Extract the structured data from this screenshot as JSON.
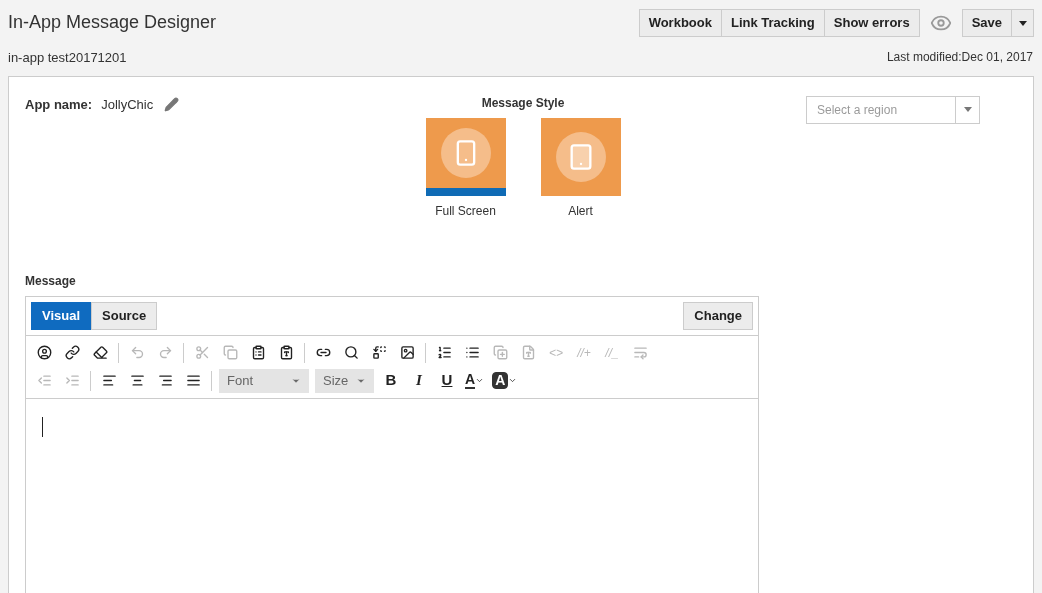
{
  "header": {
    "title": "In-App Message Designer",
    "subtitle": "in-app test20171201",
    "actions": [
      "Workbook",
      "Link Tracking",
      "Show errors"
    ],
    "save": "Save",
    "last_modified": "Last modified:Dec 01, 2017"
  },
  "app": {
    "label": "App name:",
    "value": "JollyChic"
  },
  "message_style": {
    "title": "Message Style",
    "options": [
      {
        "label": "Full Screen",
        "kind": "full",
        "selected": true
      },
      {
        "label": "Alert",
        "kind": "alert",
        "selected": false
      }
    ]
  },
  "region": {
    "placeholder": "Select a region"
  },
  "message": {
    "label": "Message",
    "tabs": [
      {
        "label": "Visual",
        "selected": true
      },
      {
        "label": "Source",
        "selected": false
      }
    ],
    "change": "Change",
    "toolbar_rows": [
      [
        {
          "kind": "user",
          "disabled": false
        },
        {
          "kind": "link",
          "disabled": false
        },
        {
          "kind": "eraser",
          "disabled": false
        },
        {
          "kind": "sep"
        },
        {
          "kind": "undo",
          "disabled": true
        },
        {
          "kind": "redo",
          "disabled": true
        },
        {
          "kind": "sep"
        },
        {
          "kind": "cut",
          "disabled": true
        },
        {
          "kind": "copy",
          "disabled": true
        },
        {
          "kind": "paste",
          "disabled": false
        },
        {
          "kind": "paste-text",
          "disabled": false
        },
        {
          "kind": "sep"
        },
        {
          "kind": "link2",
          "disabled": false
        },
        {
          "kind": "search",
          "disabled": false
        },
        {
          "kind": "replace",
          "disabled": false
        },
        {
          "kind": "image",
          "disabled": false
        },
        {
          "kind": "sep"
        },
        {
          "kind": "ordered",
          "disabled": false
        },
        {
          "kind": "bullets",
          "disabled": false
        },
        {
          "kind": "format-copy",
          "disabled": true
        },
        {
          "kind": "format-doc",
          "disabled": true
        },
        {
          "kind": "text",
          "label": "<>",
          "disabled": true
        },
        {
          "kind": "text",
          "label": "//+",
          "disabled": true
        },
        {
          "kind": "text",
          "label": "//_",
          "disabled": true
        },
        {
          "kind": "wrap",
          "disabled": true
        }
      ],
      [
        {
          "kind": "outdent",
          "disabled": true
        },
        {
          "kind": "indent",
          "disabled": true
        },
        {
          "kind": "sep"
        },
        {
          "kind": "align-left",
          "disabled": false
        },
        {
          "kind": "align-center",
          "disabled": false
        },
        {
          "kind": "align-right",
          "disabled": false
        },
        {
          "kind": "justify",
          "disabled": false
        },
        {
          "kind": "sep"
        },
        {
          "kind": "font",
          "label": "Font"
        },
        {
          "kind": "size",
          "label": "Size"
        },
        {
          "kind": "bold",
          "label": "B",
          "disabled": false
        },
        {
          "kind": "italic",
          "label": "I",
          "disabled": false
        },
        {
          "kind": "underline",
          "label": "U",
          "disabled": false
        },
        {
          "kind": "text-color",
          "label": "A",
          "disabled": false
        },
        {
          "kind": "bg-color",
          "label": "A",
          "disabled": false
        }
      ]
    ]
  }
}
